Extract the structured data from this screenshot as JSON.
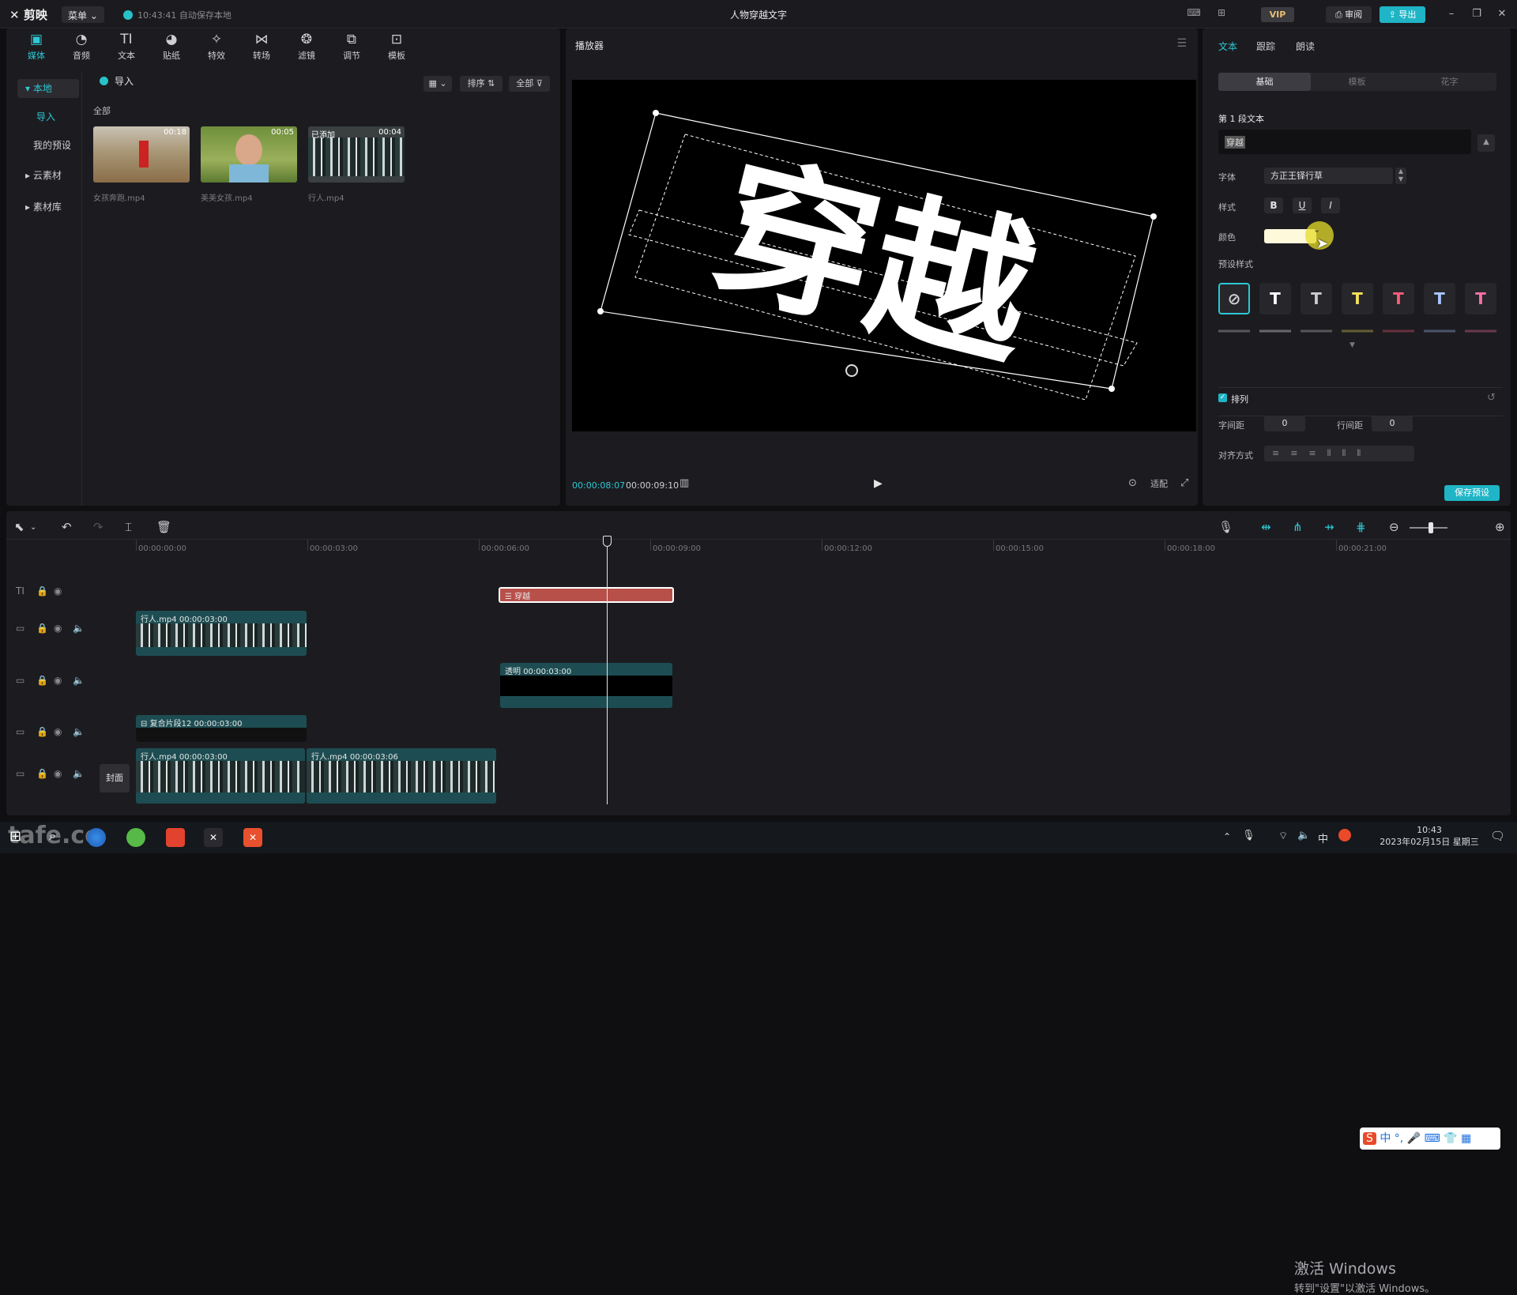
{
  "titlebar": {
    "app_name": "剪映",
    "menu_label": "菜单",
    "autosave_status": "10:43:41 自动保存本地",
    "project_title": "人物穿越文字",
    "vip_label": "VIP",
    "review_label": "审阅",
    "export_label": "导出"
  },
  "media_toolbar": [
    {
      "label": "媒体",
      "icon": "media-icon",
      "glyph": "▣"
    },
    {
      "label": "音频",
      "icon": "audio-icon",
      "glyph": "◔"
    },
    {
      "label": "文本",
      "icon": "text-icon",
      "glyph": "TI"
    },
    {
      "label": "贴纸",
      "icon": "sticker-icon",
      "glyph": "◕"
    },
    {
      "label": "特效",
      "icon": "effects-icon",
      "glyph": "✧"
    },
    {
      "label": "转场",
      "icon": "transition-icon",
      "glyph": "⋈"
    },
    {
      "label": "滤镜",
      "icon": "filter-icon",
      "glyph": "❂"
    },
    {
      "label": "调节",
      "icon": "adjust-icon",
      "glyph": "⧉"
    },
    {
      "label": "模板",
      "icon": "template-icon",
      "glyph": "⊡"
    }
  ],
  "media_nav": {
    "local": "本地",
    "import": "导入",
    "my_presets": "我的预设",
    "cloud": "云素材",
    "library": "素材库"
  },
  "media": {
    "import_button": "导入",
    "sort_label": "排序",
    "filter_label": "全部",
    "section_all": "全部",
    "items": [
      {
        "name": "女孩奔跑.mp4",
        "duration": "00:18",
        "added": ""
      },
      {
        "name": "美美女孩.mp4",
        "duration": "00:05",
        "added": ""
      },
      {
        "name": "行人.mp4",
        "duration": "00:04",
        "added": "已添加"
      }
    ]
  },
  "player": {
    "title": "播放器",
    "overlay_text": "穿越",
    "current_time": "00:00:08:07",
    "total_time": "00:00:09:10",
    "ratio_label": "适配"
  },
  "props": {
    "tabs": [
      "文本",
      "跟踪",
      "朗读"
    ],
    "subtabs": [
      "基础",
      "模板",
      "花字"
    ],
    "segment_label": "第 1 段文本",
    "text_value": "穿越",
    "font_label": "字体",
    "font_value": "方正王铎行草",
    "style_label": "样式",
    "bold": "B",
    "underline": "U",
    "italic": "I",
    "color_label": "颜色",
    "color_value": "#fff9dc",
    "preset_label": "预设样式",
    "presets": [
      {
        "glyph": "⊘",
        "color": "#cfcfd3"
      },
      {
        "glyph": "T",
        "color": "#ffffff"
      },
      {
        "glyph": "T",
        "color": "#cccccc"
      },
      {
        "glyph": "T",
        "color": "#f4e15b"
      },
      {
        "glyph": "T",
        "color": "#ff5a7a"
      },
      {
        "glyph": "T",
        "color": "#a9c7ff"
      },
      {
        "glyph": "T",
        "color": "#ff6fa8"
      }
    ],
    "arrange_label": "排列",
    "letter_spacing_label": "字间距",
    "letter_spacing_value": "0",
    "line_spacing_label": "行间距",
    "line_spacing_value": "0",
    "align_label": "对齐方式",
    "save_preset": "保存预设"
  },
  "timeline": {
    "ruler": [
      "00:00:00:00",
      "00:00:03:00",
      "00:00:06:00",
      "00:00:09:00",
      "00:00:12:00",
      "00:00:15:00",
      "00:00:18:00",
      "00:00:21:00"
    ],
    "text_clip": "穿越",
    "clip_a_name": "行人.mp4",
    "clip_a_dur": "00:00:03:00",
    "clip_b_name": "透明",
    "clip_b_dur": "00:00:03:00",
    "clip_c_name": "复合片段12",
    "clip_c_dur": "00:00:03:00",
    "main_clip1_name": "行人.mp4",
    "main_clip1_dur": "00:00:03:00",
    "main_clip2_name": "行人.mp4",
    "main_clip2_dur": "00:00:03:06",
    "cover_label": "封面"
  },
  "system": {
    "activate_title": "激活 Windows",
    "activate_sub": "转到\"设置\"以激活 Windows。",
    "clock_time": "10:43",
    "clock_date": "2023年02月15日 星期三",
    "ime_lang": "中",
    "ime_bar": "中 °, ",
    "watermark": "tafe.cc"
  }
}
